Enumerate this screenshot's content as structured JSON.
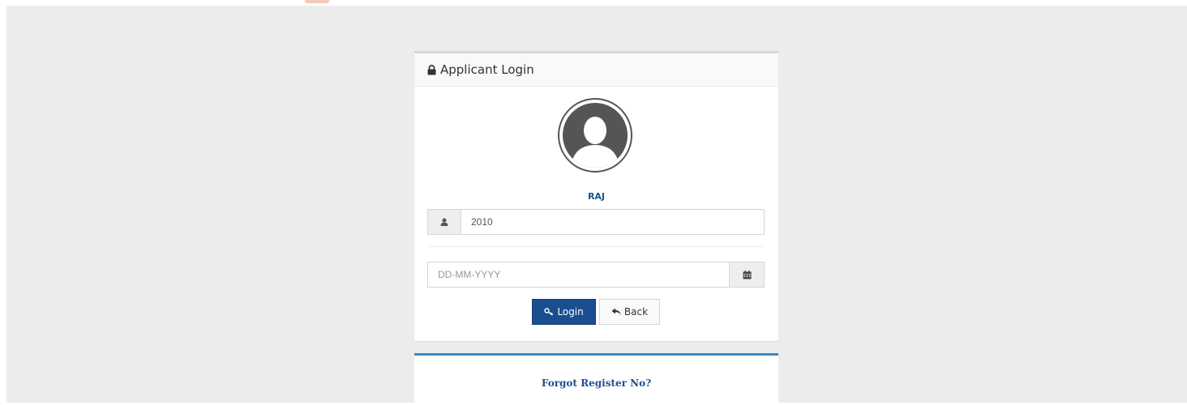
{
  "panel": {
    "title": "Applicant Login",
    "title_icon": "lock-icon",
    "avatar_icon": "user-avatar-icon"
  },
  "user": {
    "name": "RAJ"
  },
  "register_field": {
    "value": "2010",
    "icon": "user-icon"
  },
  "dob_field": {
    "placeholder": "DD-MM-YYYY",
    "value": "",
    "icon": "calendar-icon"
  },
  "buttons": {
    "login": {
      "label": "Login",
      "icon": "key-icon"
    },
    "back": {
      "label": "Back",
      "icon": "reply-icon"
    }
  },
  "forgot": {
    "label": "Forgot Register No?"
  },
  "colors": {
    "primary": "#1a4e8f",
    "accent_border": "#3c8dbc",
    "background": "#ececec"
  }
}
